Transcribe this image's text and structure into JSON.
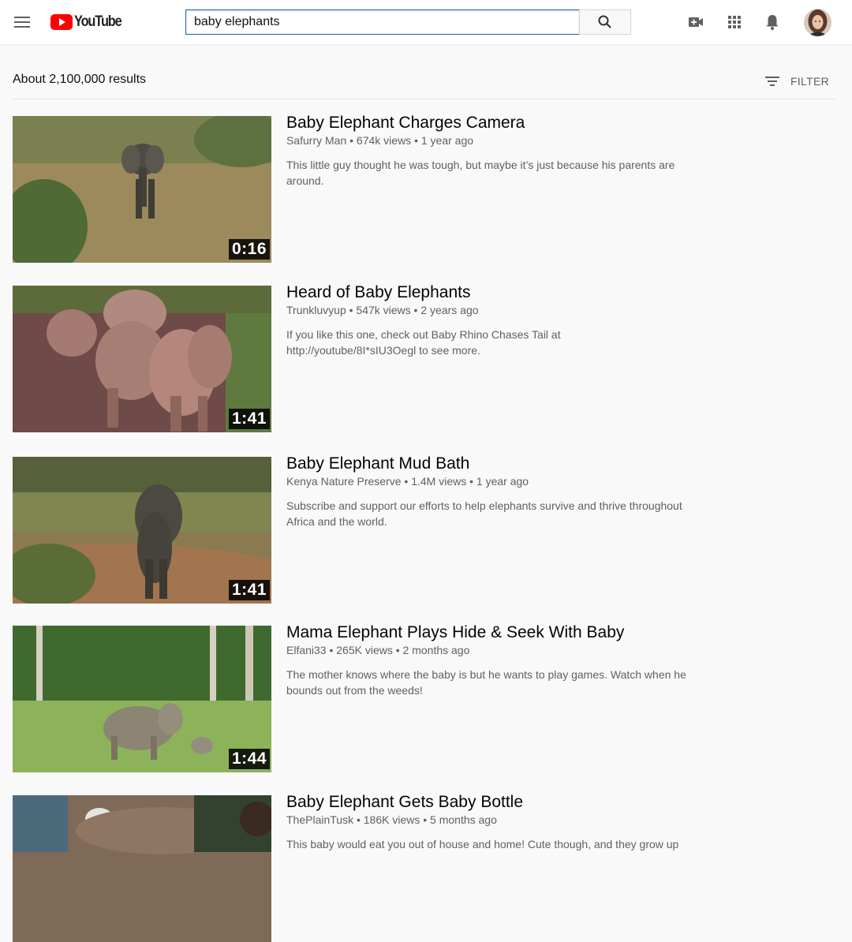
{
  "header": {
    "logo_text": "YouTube",
    "search_value": "baby elephants",
    "search_placeholder": "Search"
  },
  "results_info": {
    "count_text": "About 2,100,000 results",
    "filter_label": "FILTER"
  },
  "results": [
    {
      "title": "Baby Elephant Charges Camera",
      "meta": "Safurry Man • 674k views • 1 year ago",
      "description": "This little guy thought he was tough, but maybe it’s just because his parents are around.",
      "duration": "0:16"
    },
    {
      "title": "Heard of Baby Elephants",
      "meta": "Trunkluvyup • 547k views • 2 years ago",
      "description": "If you like this one, check out Baby Rhino Chases Tail at http://youtube/8I*sIU3Oegl to see more.",
      "duration": "1:41"
    },
    {
      "title": "Baby Elephant Mud Bath",
      "meta": "Kenya Nature Preserve • 1.4M views • 1 year ago",
      "description": "Subscribe and support our efforts to help elephants survive and thrive throughout Africa and the world.",
      "duration": "1:41"
    },
    {
      "title": "Mama Elephant Plays Hide & Seek With Baby",
      "meta": "Elfani33 • 265K views • 2 months ago",
      "description": "The mother knows where the baby is but he wants to play games. Watch when he bounds out from the weeds!",
      "duration": "1:44"
    },
    {
      "title": "Baby Elephant Gets Baby Bottle",
      "meta": "ThePlainTusk • 186K views • 5 months ago",
      "description": "This baby would eat you out of house and home! Cute though, and they grow up",
      "duration": ""
    }
  ],
  "colors": {
    "brand_red": "#ff0000",
    "search_border": "#1c62b9",
    "meta_gray": "#606060"
  }
}
